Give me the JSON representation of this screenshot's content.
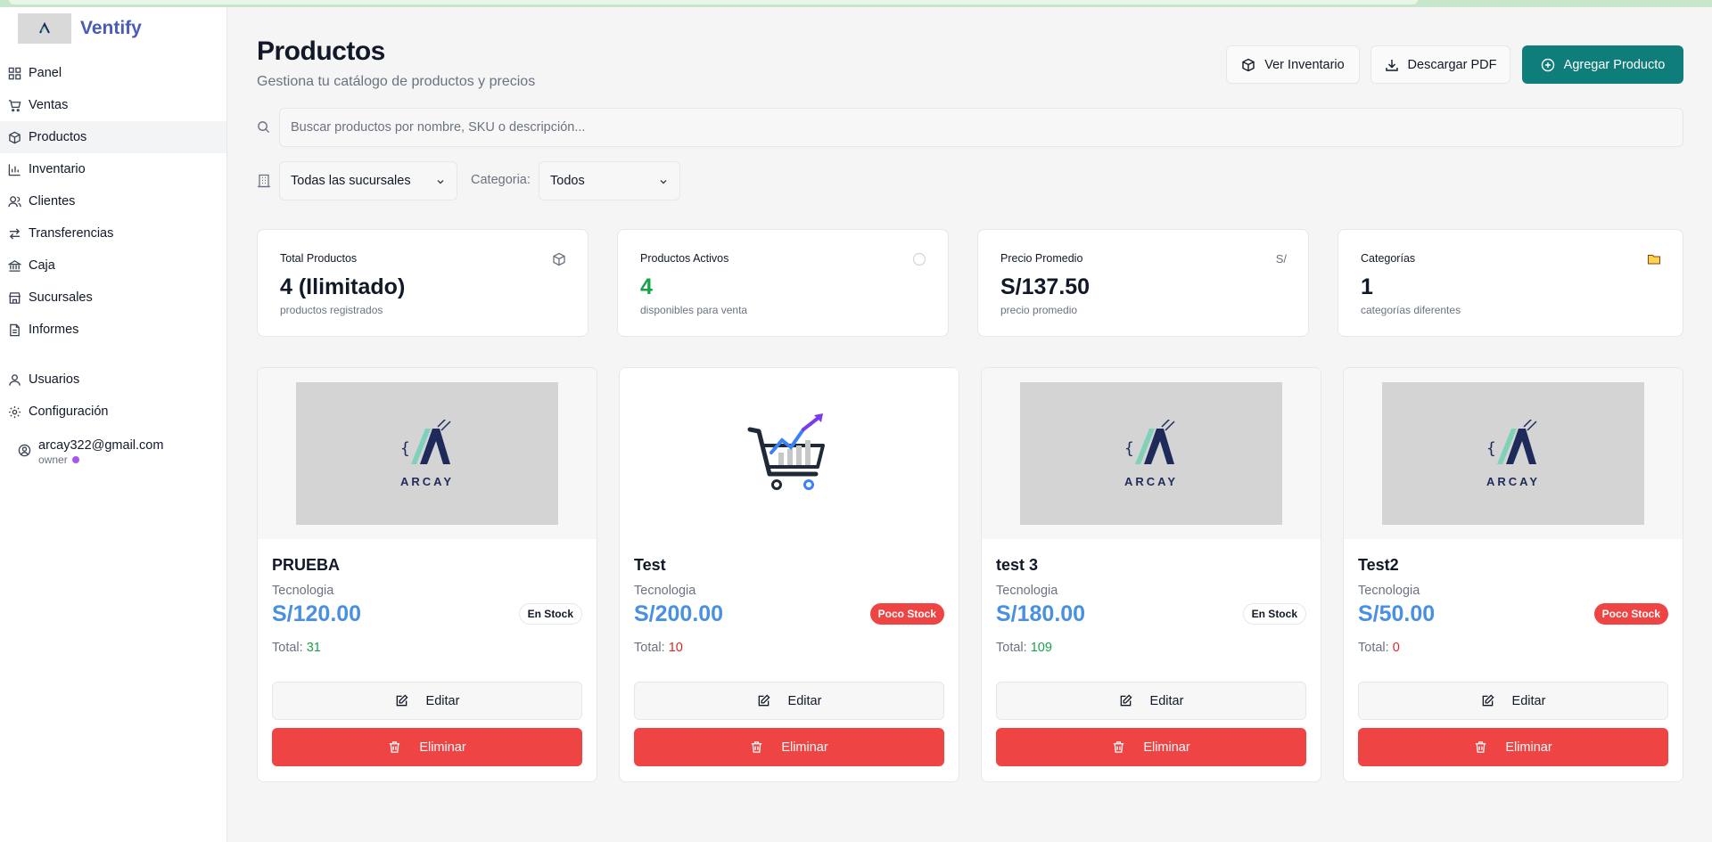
{
  "app": {
    "name": "Ventify"
  },
  "sidebar": {
    "items": [
      {
        "label": "Panel",
        "icon": "grid-icon"
      },
      {
        "label": "Ventas",
        "icon": "cart-icon"
      },
      {
        "label": "Productos",
        "icon": "box-icon",
        "active": true
      },
      {
        "label": "Inventario",
        "icon": "bar-chart-icon"
      },
      {
        "label": "Clientes",
        "icon": "users-icon"
      },
      {
        "label": "Transferencias",
        "icon": "arrows-icon"
      },
      {
        "label": "Caja",
        "icon": "bank-icon"
      },
      {
        "label": "Sucursales",
        "icon": "store-icon"
      },
      {
        "label": "Informes",
        "icon": "file-icon"
      }
    ],
    "secondary": [
      {
        "label": "Usuarios",
        "icon": "user-icon"
      },
      {
        "label": "Configuración",
        "icon": "gear-icon"
      }
    ],
    "user": {
      "email": "arcay322@gmail.com",
      "role": "owner"
    }
  },
  "header": {
    "title": "Productos",
    "subtitle": "Gestiona tu catálogo de productos y precios",
    "buttons": {
      "inventory": "Ver Inventario",
      "pdf": "Descargar PDF",
      "add": "Agregar Producto"
    }
  },
  "search": {
    "placeholder": "Buscar productos por nombre, SKU o descripción..."
  },
  "filters": {
    "branch_value": "Todas las sucursales",
    "category_label": "Categoria:",
    "category_value": "Todos"
  },
  "stats": [
    {
      "title": "Total Productos",
      "value": "4 (Ilimitado)",
      "sub": "productos registrados",
      "icon": "box-icon"
    },
    {
      "title": "Productos Activos",
      "value": "4",
      "sub": "disponibles para venta",
      "icon": "circle-icon"
    },
    {
      "title": "Precio Promedio",
      "value": "S/137.50",
      "sub": "precio promedio",
      "icon_text": "S/"
    },
    {
      "title": "Categorías",
      "value": "1",
      "sub": "categorías diferentes",
      "icon": "folder-icon"
    }
  ],
  "products": [
    {
      "name": "PRUEBA",
      "category": "Tecnologia",
      "price": "S/120.00",
      "badge": "En Stock",
      "total_label": "Total:",
      "total": "31",
      "image": "arcay",
      "image_text": "ARCAY"
    },
    {
      "name": "Test",
      "category": "Tecnologia",
      "price": "S/200.00",
      "badge": "Poco Stock",
      "total_label": "Total:",
      "total": "10",
      "image": "cart"
    },
    {
      "name": "test 3",
      "category": "Tecnologia",
      "price": "S/180.00",
      "badge": "En Stock",
      "total_label": "Total:",
      "total": "109",
      "image": "arcay",
      "image_text": "ARCAY"
    },
    {
      "name": "Test2",
      "category": "Tecnologia",
      "price": "S/50.00",
      "badge": "Poco Stock",
      "total_label": "Total:",
      "total": "0",
      "image": "arcay",
      "image_text": "ARCAY"
    }
  ],
  "card_actions": {
    "edit": "Editar",
    "delete": "Eliminar"
  },
  "colors": {
    "primary": "#0f7e7b",
    "danger": "#ef4444",
    "price": "#4a90e2",
    "brand": "#4a5cb8"
  }
}
